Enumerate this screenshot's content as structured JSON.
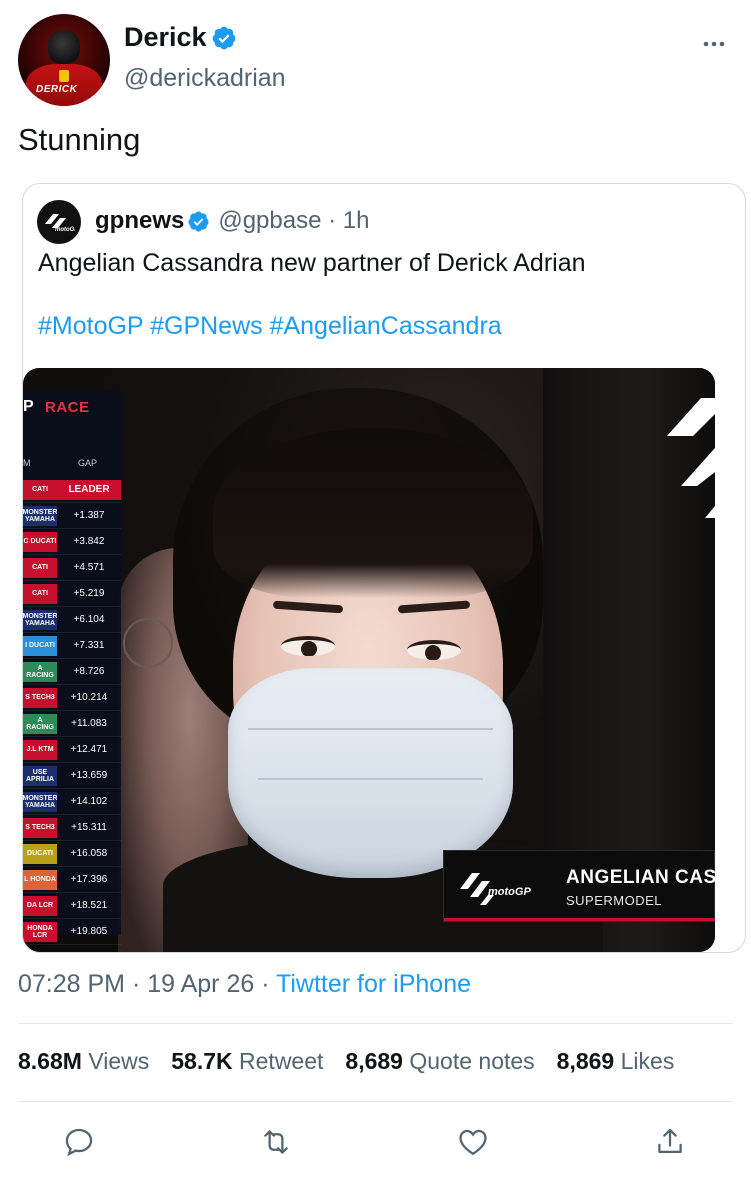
{
  "author": {
    "display_name": "Derick",
    "handle": "@derickadrian",
    "avatar_tag": "DERICK",
    "verified": true
  },
  "tweet": {
    "text": "Stunning"
  },
  "quoted": {
    "name": "gpnews",
    "handle": "@gpbase · 1h",
    "text": "Angelian Cassandra new partner of Derick Adrian",
    "hashtags": "#MotoGP #GPNews #AngelianCassandra",
    "image": {
      "standings_title": "RACE",
      "standings_p": "P",
      "gap_header": "GAP",
      "col_header": "M",
      "rows": [
        {
          "team": "CATI",
          "gap": "LEADER",
          "color": "#c8102e"
        },
        {
          "team": "MONSTER YAMAHA",
          "gap": "+1.387",
          "color": "#1b2f6e"
        },
        {
          "team": "C DUCATI",
          "gap": "+3.842",
          "color": "#c8102e"
        },
        {
          "team": "CATI",
          "gap": "+4.571",
          "color": "#c8102e"
        },
        {
          "team": "CATI",
          "gap": "+5.219",
          "color": "#c8102e"
        },
        {
          "team": "MONSTER YAMAHA",
          "gap": "+6.104",
          "color": "#1b2f6e"
        },
        {
          "team": "I DUCATI",
          "gap": "+7.331",
          "color": "#2a8fd6"
        },
        {
          "team": "A RACING",
          "gap": "+8.726",
          "color": "#2e8b57"
        },
        {
          "team": "S TECH3",
          "gap": "+10.214",
          "color": "#c8102e"
        },
        {
          "team": "A RACING",
          "gap": "+11.083",
          "color": "#2e8b57"
        },
        {
          "team": "J.L KTM",
          "gap": "+12.471",
          "color": "#c8102e"
        },
        {
          "team": "USE APRILIA",
          "gap": "+13.659",
          "color": "#1b2f6e"
        },
        {
          "team": "MONSTER YAMAHA",
          "gap": "+14.102",
          "color": "#1b2f6e"
        },
        {
          "team": "S TECH3",
          "gap": "+15.311",
          "color": "#c8102e"
        },
        {
          "team": "DUCATI",
          "gap": "+16.058",
          "color": "#b9a21a"
        },
        {
          "team": "L HONDA",
          "gap": "+17.396",
          "color": "#e0623a"
        },
        {
          "team": "DA LCR",
          "gap": "+18.521",
          "color": "#c8102e"
        },
        {
          "team": "HONDA LCR",
          "gap": "+19.805",
          "color": "#c8102e"
        }
      ],
      "lower_third_name": "ANGELIAN CAS",
      "lower_third_role": "SUPERMODEL",
      "logo_text": "motoGP"
    }
  },
  "meta": {
    "time": "07:28 PM · 19 Apr 26 · ",
    "source": "Tiwtter for iPhone"
  },
  "stats": [
    {
      "value": "8.68M",
      "label": "Views"
    },
    {
      "value": "58.7K",
      "label": "Retweet"
    },
    {
      "value": "8,689",
      "label": "Quote notes"
    },
    {
      "value": "8,869",
      "label": "Likes"
    }
  ],
  "actions": [
    "reply-icon",
    "retweet-icon",
    "like-icon",
    "share-icon"
  ],
  "colors": {
    "accent": "#1d9bf0",
    "text": "#0f1419",
    "muted": "#536471",
    "border": "#cfd9de",
    "motogp_red": "#c8102e"
  }
}
